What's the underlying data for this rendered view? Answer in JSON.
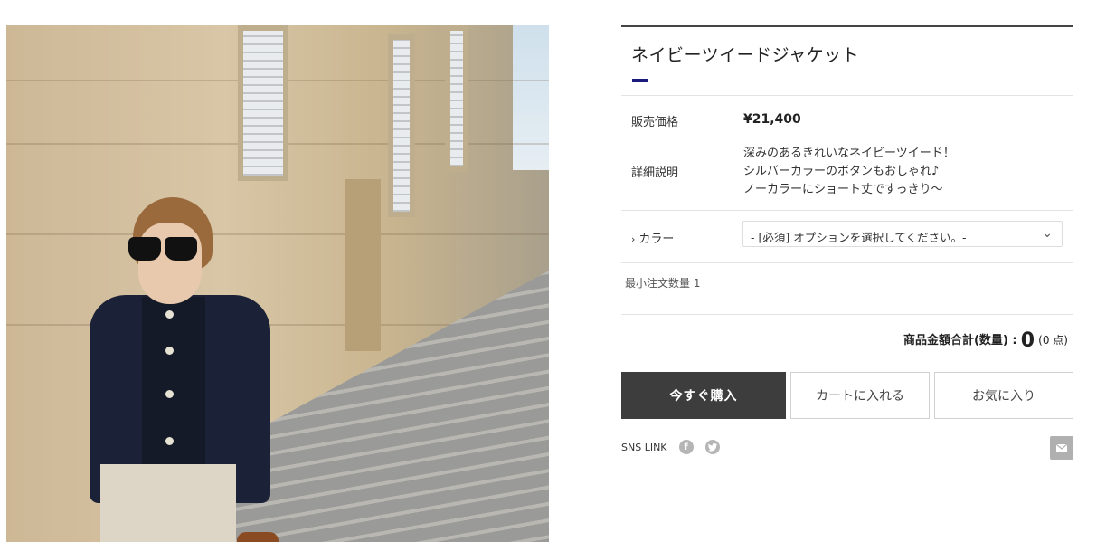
{
  "product": {
    "title": "ネイビーツイードジャケット",
    "price_label": "販売価格",
    "price": "¥21,400",
    "desc_label": "詳細説明",
    "desc_lines": [
      "深みのあるきれいなネイビーツイード！",
      "シルバーカラーのボタンもおしゃれ♪",
      "ノーカラーにショート丈ですっきり～"
    ],
    "option_label": "カラー",
    "option_placeholder": "- [必須] オプションを選択してください。-",
    "min_order": "最小注文数量 1"
  },
  "total": {
    "label": "商品金額合計(数量) :",
    "amount": "0",
    "count": "(0 点)"
  },
  "actions": {
    "buy_now": "今すぐ購入",
    "add_to_cart": "カートに入れる",
    "favorite": "お気に入り"
  },
  "sns": {
    "label": "SNS LINK",
    "icons": [
      "facebook-icon",
      "twitter-icon",
      "mail-icon"
    ]
  },
  "colors": {
    "accent": "#1a1a7a",
    "buy_button": "#3d3d3d"
  }
}
